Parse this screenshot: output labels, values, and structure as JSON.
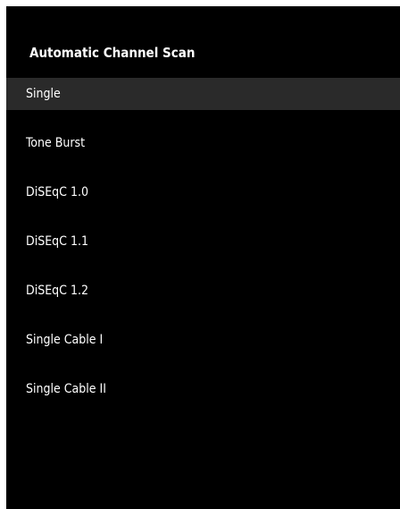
{
  "menu": {
    "title": "Automatic Channel Scan",
    "selected_index": 0,
    "items": [
      {
        "label": "Single"
      },
      {
        "label": "Tone Burst"
      },
      {
        "label": "DiSEqC 1.0"
      },
      {
        "label": "DiSEqC 1.1"
      },
      {
        "label": "DiSEqC 1.2"
      },
      {
        "label": "Single Cable I"
      },
      {
        "label": "Single Cable II"
      }
    ]
  },
  "colors": {
    "background": "#000000",
    "highlight": "#2a2a2a",
    "text": "#ffffff"
  }
}
